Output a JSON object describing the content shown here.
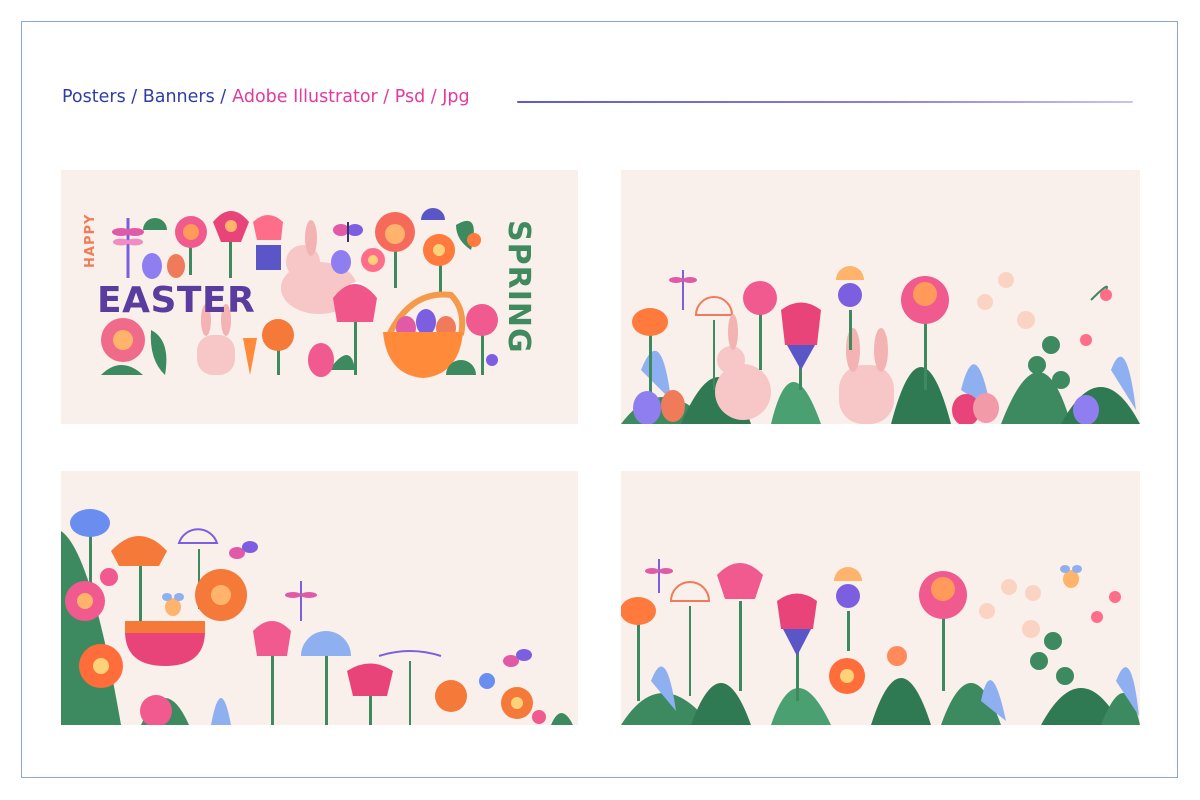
{
  "header": {
    "left_text": "Posters / Banners /",
    "right_text": "Adobe Illustrator / Psd / Jpg"
  },
  "poster1": {
    "word_happy": "HAPPY",
    "word_easter": "EASTER",
    "word_spring": "SPRING"
  },
  "colors": {
    "frame": "#8ea3e6",
    "header_blue": "#2f3ea6",
    "header_pink": "#e23aa0",
    "panel_bg": "#f9efeb",
    "easter_purple": "#5a3c9e",
    "spring_green": "#3f8a5e",
    "happy_orange": "#f07c57"
  }
}
